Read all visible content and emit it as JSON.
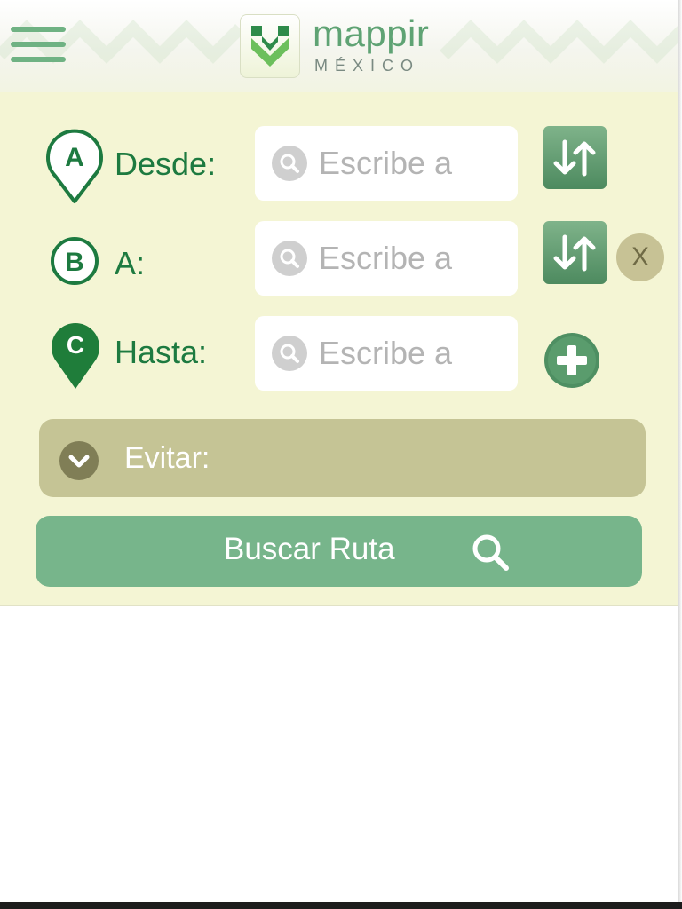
{
  "header": {
    "logo_name": "mappir",
    "logo_country": "MÉXICO"
  },
  "route_form": {
    "from": {
      "marker_letter": "A",
      "label": "Desde:",
      "placeholder": "Escribe a"
    },
    "via": {
      "marker_letter": "B",
      "label": "A:",
      "placeholder": "Escribe a",
      "remove_label": "X"
    },
    "to": {
      "marker_letter": "C",
      "label": "Hasta:",
      "placeholder": "Escribe a"
    },
    "avoid_label": "Evitar:",
    "search_button_label": "Buscar Ruta"
  },
  "icons": {
    "menu": "hamburger-menu-icon",
    "search": "magnifier-icon",
    "swap": "swap-arrows-icon",
    "add": "plus-circle-icon",
    "expand": "chevron-down-icon"
  },
  "colors": {
    "brand_green": "#1d7a40",
    "button_green": "#77b58b",
    "panel_bg": "#f4f5d4",
    "avoid_bar": "#c5c495"
  }
}
